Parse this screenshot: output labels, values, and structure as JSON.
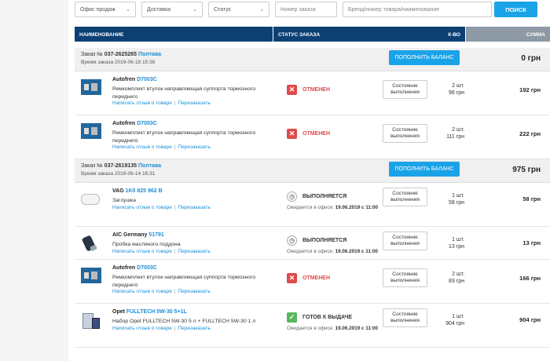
{
  "filters": {
    "office": "Офис продаж",
    "delivery": "Доставка",
    "status": "Статус",
    "order_placeholder": "Номер заказа",
    "brand_placeholder": "Бренд/номер товара/наименование",
    "search_label": "ПОИСК"
  },
  "table_header": {
    "name": "НАИМЕНОВАНИЕ",
    "status": "СТАТУС ЗАКАЗА",
    "qty": "К-ВО",
    "sum": "СУММА"
  },
  "orders": [
    {
      "label": "Заказ №",
      "number": "037-2625265",
      "city": "Полтава",
      "time": "Время заказа 2019-06-18 15:38",
      "fund_label": "ПОПОЛНИТЬ БАЛАНС",
      "total": "0 грн",
      "items": [
        {
          "thumb": "brake-kit",
          "brand": "Autofren",
          "code": "D7003C",
          "desc": "Ремкомплект втулок направляющая суппорта тормозного переднего",
          "review": "Написать отзыв о товаре",
          "reorder": "Перезаказать",
          "status_icon": "cancel",
          "status": "ОТМЕНЕН",
          "expect": "",
          "state_btn": "Состояние выполнения",
          "qty": "2 шт.",
          "price": "96 грн",
          "sum": "192 грн"
        },
        {
          "thumb": "brake-kit",
          "brand": "Autofren",
          "code": "D7003C",
          "desc": "Ремкомплект втулок направляющая суппорта тормозного переднего",
          "review": "Написать отзыв о товаре",
          "reorder": "Перезаказать",
          "status_icon": "cancel",
          "status": "ОТМЕНЕН",
          "expect": "",
          "state_btn": "Состояние выполнения",
          "qty": "2 шт.",
          "price": "111 грн",
          "sum": "222 грн"
        }
      ]
    },
    {
      "label": "Заказ №",
      "number": "037-2619135",
      "city": "Полтава",
      "time": "Время заказа 2019-06-14 16:31",
      "fund_label": "ПОПОЛНИТЬ БАЛАНС",
      "total": "975 грн",
      "items": [
        {
          "thumb": "cap",
          "brand": "VAG",
          "code": "1K0 825 962 B",
          "desc": "Заглушка",
          "review": "Написать отзыв о товаре",
          "reorder": "Перезаказать",
          "status_icon": "clock",
          "status": "ВЫПОЛНЯЕТСЯ",
          "expect_label": "Ожидается в офисе:",
          "expect": "19.06.2019 с 11:00",
          "state_btn": "Состояние выполнения",
          "qty": "1 шт.",
          "price": "58 грн",
          "sum": "58 грн"
        },
        {
          "thumb": "sensor",
          "brand": "AIC Germany",
          "code": "51791",
          "desc": "Пробка масляного поддона",
          "review": "Написать отзыв о товаре",
          "reorder": "Перезаказать",
          "status_icon": "clock",
          "status": "ВЫПОЛНЯЕТСЯ",
          "expect_label": "Ожидается в офисе:",
          "expect": "19.06.2019 с 11:00",
          "state_btn": "Состояние выполнения",
          "qty": "1 шт.",
          "price": "13 грн",
          "sum": "13 грн"
        },
        {
          "thumb": "brake-kit",
          "brand": "Autofren",
          "code": "D7003C",
          "desc": "Ремкомплект втулок направляющая суппорта тормозного переднего",
          "review": "Написать отзыв о товаре",
          "reorder": "Перезаказать",
          "status_icon": "cancel",
          "status": "ОТМЕНЕН",
          "expect": "",
          "state_btn": "Состояние выполнения",
          "qty": "2 шт.",
          "price": "83 грн",
          "sum": "166 грн"
        },
        {
          "thumb": "oil",
          "brand": "Opet",
          "code": "FULLTECH 5W-30 5+1L",
          "desc": "Набор Opet FULLTECH 5W-30 5 л + FULLTECH 5W-30 1 л",
          "review": "Написать отзыв о товаре",
          "reorder": "Перезаказать",
          "status_icon": "ready",
          "status": "ГОТОВ К ВЫДАЧЕ",
          "expect_label": "Ожидается в офисе:",
          "expect": "19.06.2019 с 11:00",
          "state_btn": "Состояние выполнения",
          "qty": "1 шт.",
          "price": "904 грн",
          "sum": "904 грн"
        }
      ]
    }
  ],
  "colors": {
    "accent": "#1aa3e8",
    "header": "#0d4174",
    "cancel": "#e04a4a",
    "ready": "#58b85c"
  }
}
